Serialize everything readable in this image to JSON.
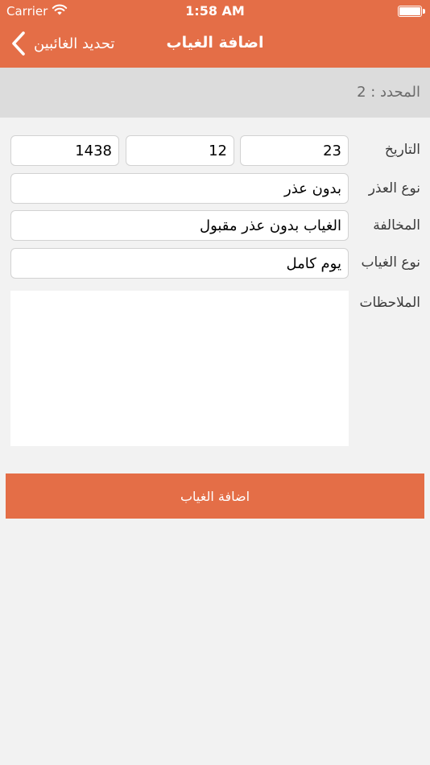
{
  "status_bar": {
    "carrier": "Carrier",
    "time": "1:58 AM"
  },
  "nav": {
    "back_label": "تحديد الغائبين",
    "title": "اضافة الغياب"
  },
  "selected": {
    "text": "المحدد : 2"
  },
  "form": {
    "date": {
      "label": "التاريخ",
      "day": "23",
      "month": "12",
      "year": "1438"
    },
    "excuse_type": {
      "label": "نوع العذر",
      "value": "بدون عذر"
    },
    "violation": {
      "label": "المخالفة",
      "value": "الغياب بدون عذر مقبول"
    },
    "absence_type": {
      "label": "نوع الغياب",
      "value": "يوم كامل"
    },
    "notes": {
      "label": "الملاحظات",
      "value": ""
    }
  },
  "submit_label": "اضافة الغياب",
  "colors": {
    "accent": "#e46e47",
    "selected_bar": "#dcdcdc",
    "background": "#f2f2f2"
  },
  "icons": {
    "back": "chevron-left-icon",
    "wifi": "wifi-icon",
    "battery": "battery-icon"
  }
}
